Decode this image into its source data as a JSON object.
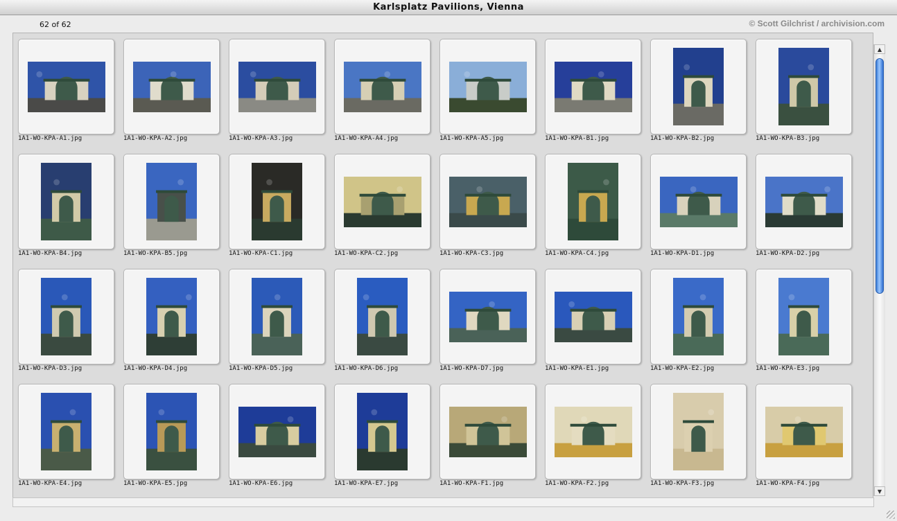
{
  "window": {
    "title": "Karlsplatz Pavilions, Vienna"
  },
  "header": {
    "count": "62 of 62",
    "copyright": "© Scott Gilchrist / archivision.com"
  },
  "icons": {
    "scroll_up": "arrow-up-icon",
    "scroll_down": "arrow-down-icon",
    "resize": "resize-grip-icon"
  },
  "images": [
    {
      "file": "1A1-WO-KPA-A1.jpg",
      "orient": "land",
      "sky": "#2f54a8",
      "ground": "#4a4a48",
      "bld": "#d8d2c0"
    },
    {
      "file": "1A1-WO-KPA-A2.jpg",
      "orient": "land",
      "sky": "#3c64b8",
      "ground": "#5a5a52",
      "bld": "#e0dccc"
    },
    {
      "file": "1A1-WO-KPA-A3.jpg",
      "orient": "land",
      "sky": "#2b4da0",
      "ground": "#8a8a84",
      "bld": "#d4ccb8"
    },
    {
      "file": "1A1-WO-KPA-A4.jpg",
      "orient": "land",
      "sky": "#4a76c4",
      "ground": "#6a6a62",
      "bld": "#d6cfb4"
    },
    {
      "file": "1A1-WO-KPA-A5.jpg",
      "orient": "land",
      "sky": "#8aaed8",
      "ground": "#3a4a30",
      "bld": "#c8ccc8"
    },
    {
      "file": "1A1-WO-KPA-B1.jpg",
      "orient": "land",
      "sky": "#263f9a",
      "ground": "#7a7a72",
      "bld": "#e0dac4"
    },
    {
      "file": "1A1-WO-KPA-B2.jpg",
      "orient": "port",
      "sky": "#22408e",
      "ground": "#6a6a64",
      "bld": "#ddd6be"
    },
    {
      "file": "1A1-WO-KPA-B3.jpg",
      "orient": "port",
      "sky": "#2a4a9c",
      "ground": "#3a5040",
      "bld": "#cfc8a8"
    },
    {
      "file": "1A1-WO-KPA-B4.jpg",
      "orient": "port",
      "sky": "#283e70",
      "ground": "#3e5a48",
      "bld": "#d2caa8"
    },
    {
      "file": "1A1-WO-KPA-B5.jpg",
      "orient": "port",
      "sky": "#3a66c0",
      "ground": "#9a9a90",
      "bld": "#48504a"
    },
    {
      "file": "1A1-WO-KPA-C1.jpg",
      "orient": "port",
      "sky": "#2a2a26",
      "ground": "#2a3a30",
      "bld": "#c8aa60"
    },
    {
      "file": "1A1-WO-KPA-C2.jpg",
      "orient": "land",
      "sky": "#d0c488",
      "ground": "#2a3a30",
      "bld": "#a8a070"
    },
    {
      "file": "1A1-WO-KPA-C3.jpg",
      "orient": "land",
      "sky": "#4a6068",
      "ground": "#3a4a4a",
      "bld": "#c8a850"
    },
    {
      "file": "1A1-WO-KPA-C4.jpg",
      "orient": "port",
      "sky": "#3c5a48",
      "ground": "#2e4a3a",
      "bld": "#c8a850"
    },
    {
      "file": "1A1-WO-KPA-D1.jpg",
      "orient": "land",
      "sky": "#3a66c0",
      "ground": "#5a7a68",
      "bld": "#d8d2bc"
    },
    {
      "file": "1A1-WO-KPA-D2.jpg",
      "orient": "land",
      "sky": "#4a74c8",
      "ground": "#2a3a34",
      "bld": "#e0dcc8"
    },
    {
      "file": "1A1-WO-KPA-D3.jpg",
      "orient": "port",
      "sky": "#2a58b8",
      "ground": "#3a4a40",
      "bld": "#d0cab0"
    },
    {
      "file": "1A1-WO-KPA-D4.jpg",
      "orient": "port",
      "sky": "#3460c0",
      "ground": "#2e3e36",
      "bld": "#d8d0b0"
    },
    {
      "file": "1A1-WO-KPA-D5.jpg",
      "orient": "port",
      "sky": "#2c5ab8",
      "ground": "#4a6258",
      "bld": "#dcd4bc"
    },
    {
      "file": "1A1-WO-KPA-D6.jpg",
      "orient": "port",
      "sky": "#2a5cc0",
      "ground": "#3a4a42",
      "bld": "#cfc8b0"
    },
    {
      "file": "1A1-WO-KPA-D7.jpg",
      "orient": "land",
      "sky": "#3464c4",
      "ground": "#4a6258",
      "bld": "#e0d8c0"
    },
    {
      "file": "1A1-WO-KPA-E1.jpg",
      "orient": "land",
      "sky": "#2a58bc",
      "ground": "#3a4a42",
      "bld": "#d8d0b4"
    },
    {
      "file": "1A1-WO-KPA-E2.jpg",
      "orient": "port",
      "sky": "#3a6ac8",
      "ground": "#4a6a58",
      "bld": "#d4ccb0"
    },
    {
      "file": "1A1-WO-KPA-E3.jpg",
      "orient": "port",
      "sky": "#4a7ad0",
      "ground": "#4a6a58",
      "bld": "#d8d0a8"
    },
    {
      "file": "1A1-WO-KPA-E4.jpg",
      "orient": "port",
      "sky": "#2a50b0",
      "ground": "#4a5a48",
      "bld": "#c8b070"
    },
    {
      "file": "1A1-WO-KPA-E5.jpg",
      "orient": "port",
      "sky": "#2c54b4",
      "ground": "#3a5040",
      "bld": "#b89a58"
    },
    {
      "file": "1A1-WO-KPA-E6.jpg",
      "orient": "land",
      "sky": "#1e3c98",
      "ground": "#3a4a40",
      "bld": "#d8cca0"
    },
    {
      "file": "1A1-WO-KPA-E7.jpg",
      "orient": "port",
      "sky": "#1e3c98",
      "ground": "#2a3a30",
      "bld": "#d4c890"
    },
    {
      "file": "1A1-WO-KPA-F1.jpg",
      "orient": "land",
      "sky": "#b8a878",
      "ground": "#3a4a38",
      "bld": "#d0c498"
    },
    {
      "file": "1A1-WO-KPA-F2.jpg",
      "orient": "land",
      "sky": "#e0d8b8",
      "ground": "#c8a040",
      "bld": "#e4dcc0"
    },
    {
      "file": "1A1-WO-KPA-F3.jpg",
      "orient": "port",
      "sky": "#d8ccac",
      "ground": "#c8b890",
      "bld": "#dcd0b0"
    },
    {
      "file": "1A1-WO-KPA-F4.jpg",
      "orient": "land",
      "sky": "#d8cca8",
      "ground": "#c8a040",
      "bld": "#e0c870"
    }
  ]
}
